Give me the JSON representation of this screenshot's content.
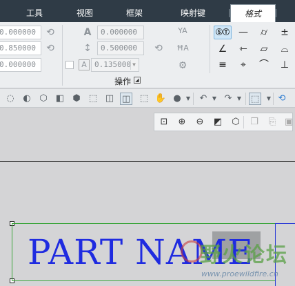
{
  "tabs": [
    {
      "label": "工具"
    },
    {
      "label": "视图"
    },
    {
      "label": "框架"
    },
    {
      "label": "映射键"
    },
    {
      "label": "格式"
    }
  ],
  "left_group": {
    "fields": [
      "0.000000",
      "0.850000",
      "0.000000"
    ]
  },
  "mid_group": {
    "fields": [
      "0.000000",
      "0.500000",
      "0.135000"
    ],
    "label": "操作"
  },
  "toolbar": {
    "undo": "↶",
    "redo": "↷"
  },
  "drawing": {
    "title_text": "PART NAME"
  },
  "watermark": {
    "text": "野火论坛",
    "url": "www.proewildfire.cn"
  },
  "colors": {
    "tabbar": "#2f3b46",
    "drawing_text": "#1f2be0",
    "box_border": "#3aa53a"
  }
}
